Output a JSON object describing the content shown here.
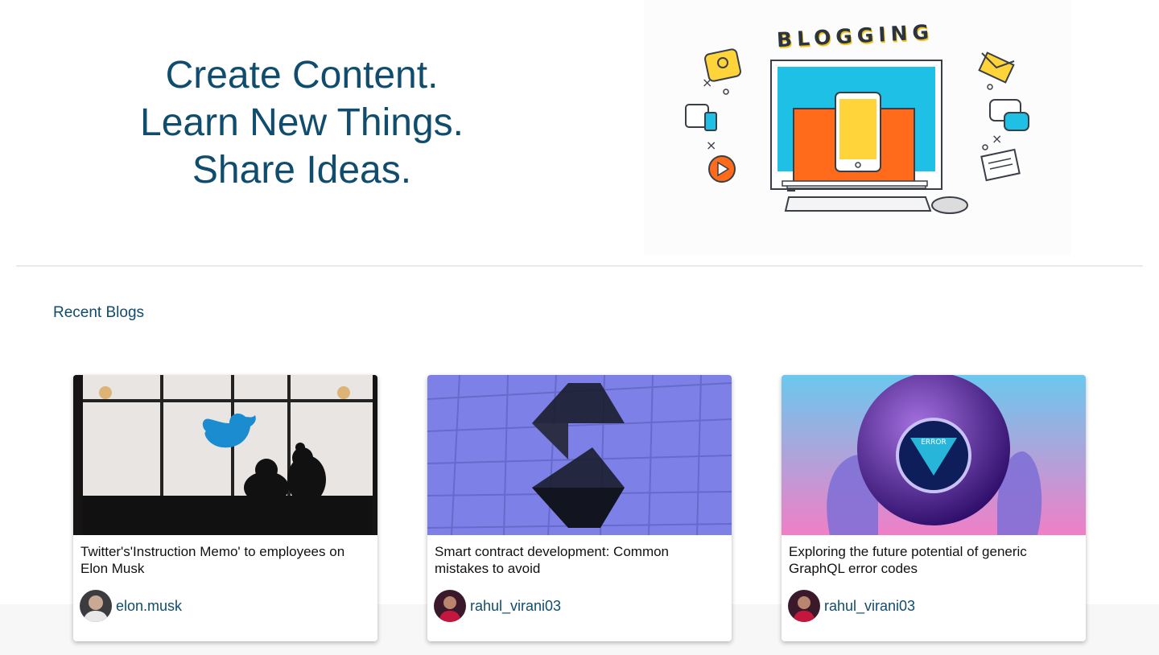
{
  "hero": {
    "lines": [
      "Create Content.",
      "Learn New Things.",
      "Share Ideas."
    ],
    "illustration_word": "BLOGGING"
  },
  "section": {
    "title": "Recent Blogs"
  },
  "cards": [
    {
      "title": "Twitter's'Instruction Memo' to employees on Elon Musk",
      "author": "elon.musk",
      "image": "twitter-office-silhouette"
    },
    {
      "title": "Smart contract development: Common mistakes to avoid",
      "author": "rahul_virani03",
      "image": "solidity-logo-on-tiles"
    },
    {
      "title": "Exploring the future potential of generic GraphQL error codes",
      "author": "rahul_virani03",
      "image": "graphql-error-magic-ball"
    }
  ],
  "colors": {
    "brand_text": "#0f4c6e",
    "divider": "#d9d9d9"
  }
}
